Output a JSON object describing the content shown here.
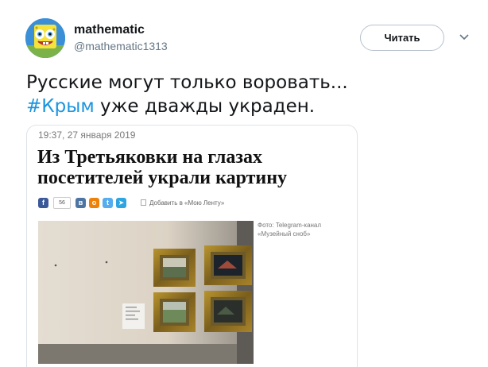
{
  "tweet": {
    "author": {
      "display_name": "mathematic",
      "handle": "@mathematic1313",
      "avatar_icon": "spongebob-avatar"
    },
    "follow_label": "Читать",
    "caret_icon": "chevron-down-icon",
    "text_line1": "Русские могут только воровать...",
    "hashtag": "#Крым",
    "text_line2_rest": " уже дважды украден.",
    "colors": {
      "link": "#1b95e0",
      "text": "#14171a",
      "secondary": "#657786"
    }
  },
  "article": {
    "date": "19:37, 27 января 2019",
    "headline_line1": "Из Третьяковки на глазах",
    "headline_line2": "посетителей украли картину",
    "share": {
      "count": "56",
      "add_label": "Добавить в «Мою Ленту»",
      "buttons": [
        {
          "icon": "facebook-icon",
          "color": "#3b5998",
          "glyph": "f"
        },
        {
          "icon": "vk-icon",
          "color": "#4c75a3",
          "glyph": "в"
        },
        {
          "icon": "odnoklassniki-icon",
          "color": "#ee8208",
          "glyph": "о"
        },
        {
          "icon": "twitter-icon",
          "color": "#55acee",
          "glyph": "t"
        },
        {
          "icon": "telegram-icon",
          "color": "#2ca5e0",
          "glyph": "➤"
        }
      ]
    },
    "photo_caption": "Фото: Telegram-канал «Музейный сноб»"
  }
}
